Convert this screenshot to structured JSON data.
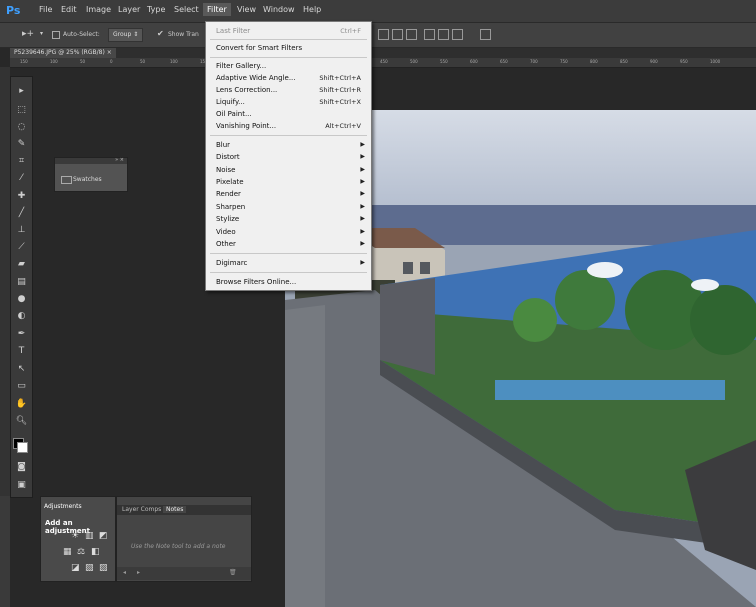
{
  "app": {
    "logo": "Ps"
  },
  "menubar": [
    "File",
    "Edit",
    "Image",
    "Layer",
    "Type",
    "Select",
    "Filter",
    "View",
    "Window",
    "Help"
  ],
  "options": {
    "auto_select": "Auto-Select:",
    "group_value": "Group",
    "show_transform": "Show Tran"
  },
  "document": {
    "tab": "P5239646.JPG @ 25% (RGB/8)"
  },
  "ruler": [
    "150",
    "100",
    "50",
    "0",
    "50",
    "100",
    "150",
    "200",
    "250",
    "300",
    "350",
    "400",
    "450",
    "500",
    "550",
    "600",
    "650",
    "700",
    "750",
    "800",
    "850",
    "900",
    "950",
    "1000"
  ],
  "filter_menu": {
    "last_filter": "Last Filter",
    "last_filter_shortcut": "Ctrl+F",
    "convert_smart": "Convert for Smart Filters",
    "items_a": [
      {
        "label": "Filter Gallery...",
        "shortcut": ""
      },
      {
        "label": "Adaptive Wide Angle...",
        "shortcut": "Shift+Ctrl+A"
      },
      {
        "label": "Lens Correction...",
        "shortcut": "Shift+Ctrl+R"
      },
      {
        "label": "Liquify...",
        "shortcut": "Shift+Ctrl+X"
      },
      {
        "label": "Oil Paint...",
        "shortcut": ""
      },
      {
        "label": "Vanishing Point...",
        "shortcut": "Alt+Ctrl+V"
      }
    ],
    "submenus": [
      "Blur",
      "Distort",
      "Noise",
      "Pixelate",
      "Render",
      "Sharpen",
      "Stylize",
      "Video",
      "Other"
    ],
    "digimarc": "Digimarc",
    "browse": "Browse Filters Online..."
  },
  "swatches_panel": {
    "label": "Swatches"
  },
  "adjustments_panel": {
    "tab": "Adjustments",
    "title": "Add an adjustment"
  },
  "notes_panel": {
    "tabs": [
      "Layer Comps",
      "Notes"
    ],
    "hint": "Use the Note tool to add a note"
  },
  "colors": {
    "accent": "#3fa0ff",
    "menu_bg": "#f0f0f0",
    "ui_dark": "#282828"
  }
}
